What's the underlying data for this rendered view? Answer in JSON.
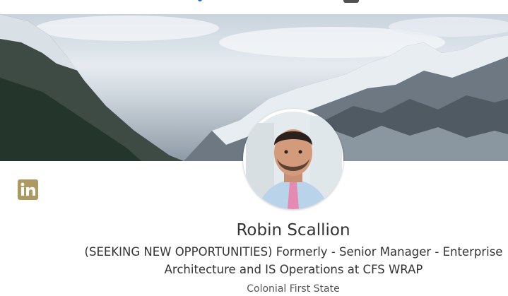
{
  "profile": {
    "name": "Robin Scallion",
    "headline": "(SEEKING NEW OPPORTUNITIES) Formerly - Senior Manager - Enterprise Architecture and IS Operations at CFS WRAP",
    "company": "Colonial First State"
  },
  "icons": {
    "brand_logo": "linkedin-icon",
    "avatar": "profile-photo"
  },
  "colors": {
    "brand_logo": "#ac9a62",
    "text": "#333333"
  }
}
